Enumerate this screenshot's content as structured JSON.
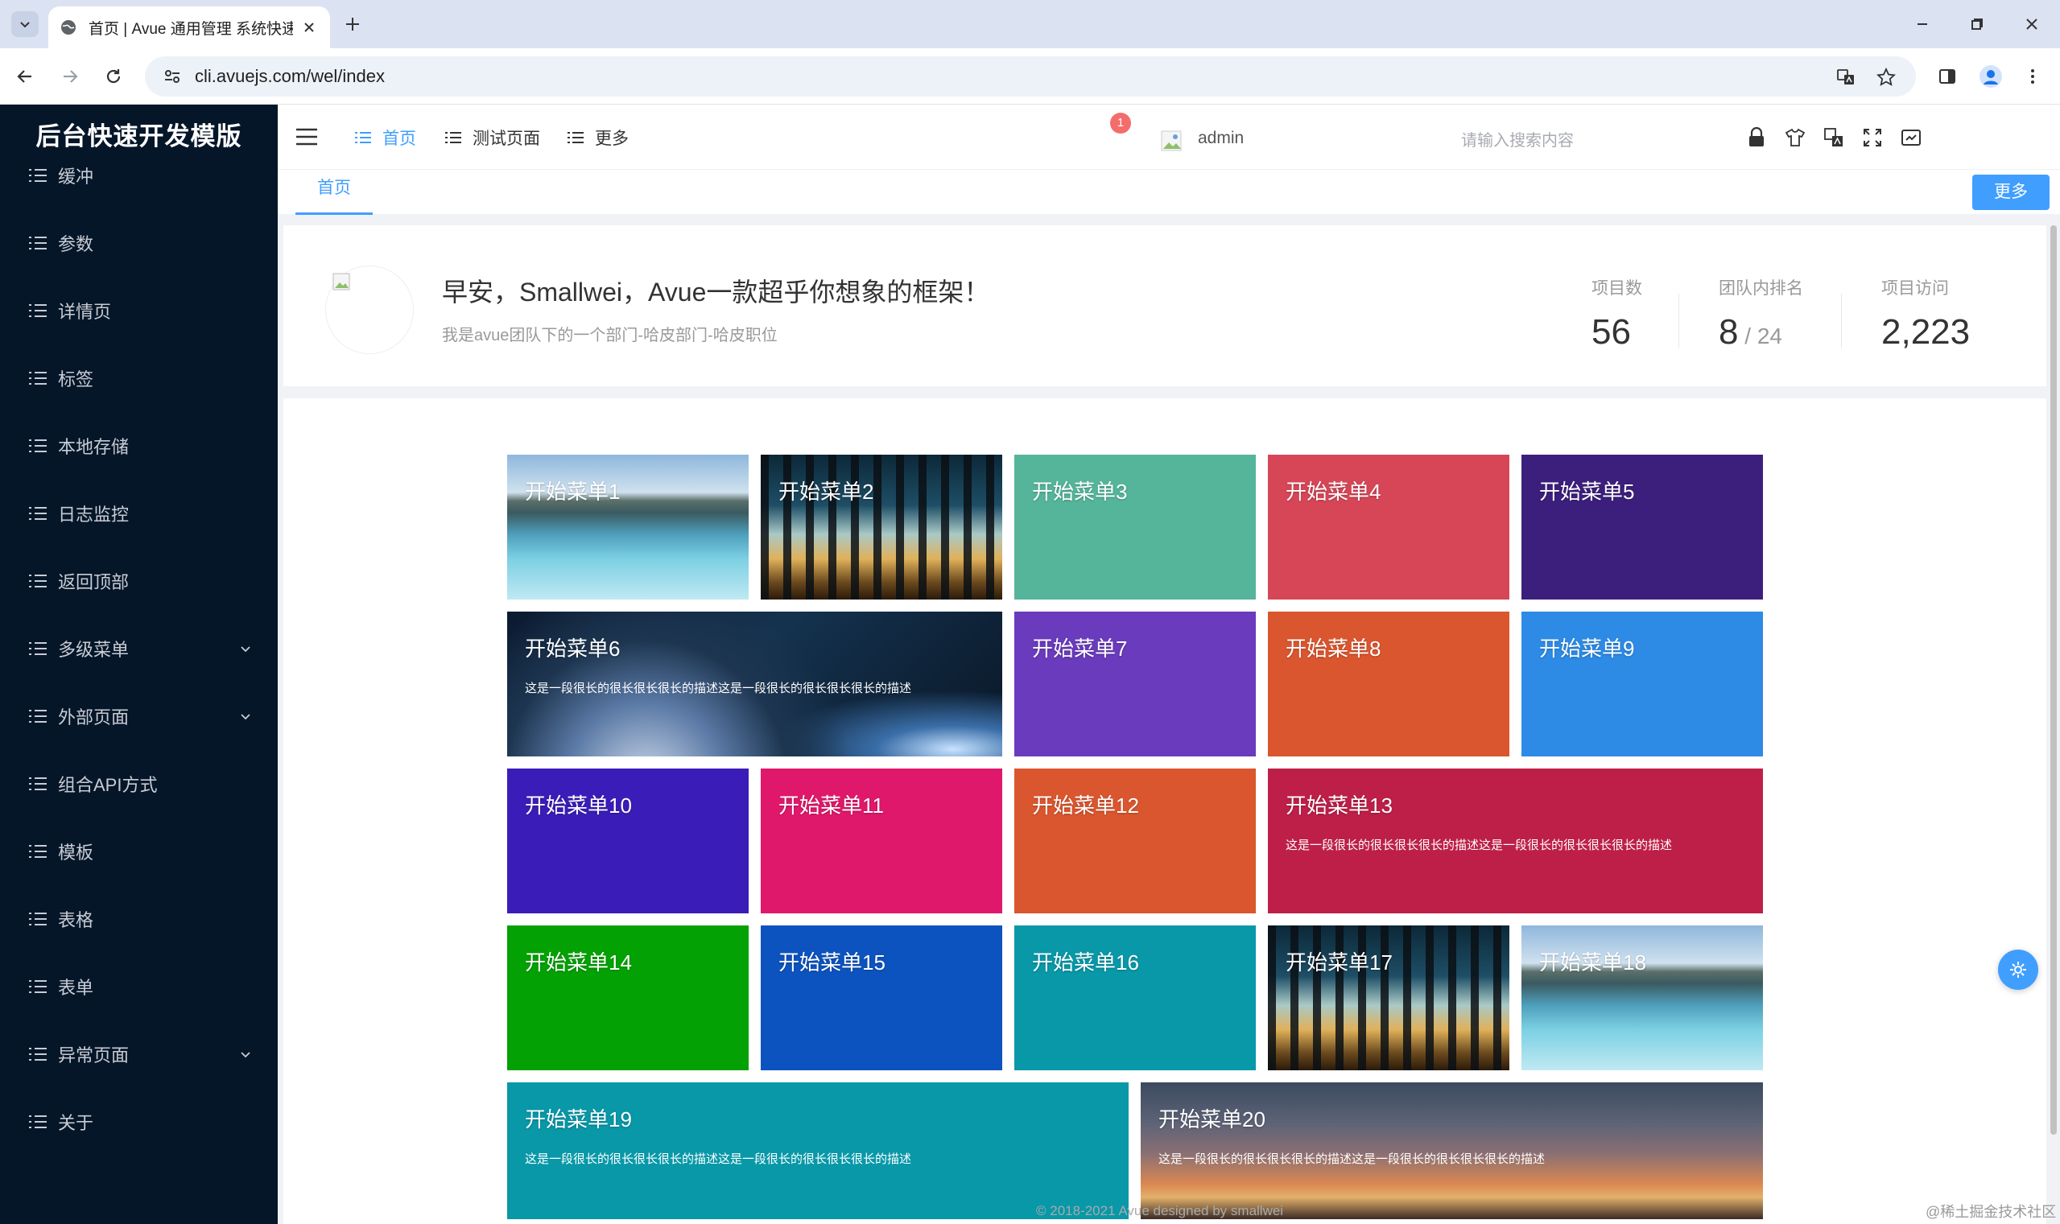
{
  "browser": {
    "tab_title": "首页 | Avue 通用管理 系统快速",
    "url": "cli.avuejs.com/wel/index"
  },
  "sidebar": {
    "logo": "后台快速开发模版",
    "items": [
      {
        "label": "缓冲",
        "expandable": false
      },
      {
        "label": "参数",
        "expandable": false
      },
      {
        "label": "详情页",
        "expandable": false
      },
      {
        "label": "标签",
        "expandable": false
      },
      {
        "label": "本地存储",
        "expandable": false
      },
      {
        "label": "日志监控",
        "expandable": false
      },
      {
        "label": "返回顶部",
        "expandable": false
      },
      {
        "label": "多级菜单",
        "expandable": true
      },
      {
        "label": "外部页面",
        "expandable": true
      },
      {
        "label": "组合API方式",
        "expandable": false
      },
      {
        "label": "模板",
        "expandable": false
      },
      {
        "label": "表格",
        "expandable": false
      },
      {
        "label": "表单",
        "expandable": false
      },
      {
        "label": "异常页面",
        "expandable": true
      },
      {
        "label": "关于",
        "expandable": false
      }
    ]
  },
  "header": {
    "nav": [
      "首页",
      "测试页面",
      "更多"
    ],
    "search_placeholder": "请输入搜索内容",
    "badge_count": "1",
    "username": "admin"
  },
  "tags": {
    "home": "首页",
    "more": "更多"
  },
  "welcome": {
    "greeting": "早安，Smallwei，Avue一款超乎你想象的框架！",
    "subline": "我是avue团队下的一个部门-哈皮部门-哈皮职位",
    "stats": [
      {
        "label": "项目数",
        "value": "56",
        "suffix": ""
      },
      {
        "label": "团队内排名",
        "value": "8",
        "suffix": " / 24"
      },
      {
        "label": "项目访问",
        "value": "2,223",
        "suffix": ""
      }
    ]
  },
  "tiles": [
    {
      "title": "开始菜单1",
      "desc": ""
    },
    {
      "title": "开始菜单2",
      "desc": ""
    },
    {
      "title": "开始菜单3",
      "desc": ""
    },
    {
      "title": "开始菜单4",
      "desc": ""
    },
    {
      "title": "开始菜单5",
      "desc": ""
    },
    {
      "title": "开始菜单6",
      "desc": "这是一段很长的很长很长很长的描述这是一段很长的很长很长很长的描述"
    },
    {
      "title": "开始菜单7",
      "desc": ""
    },
    {
      "title": "开始菜单8",
      "desc": ""
    },
    {
      "title": "开始菜单9",
      "desc": ""
    },
    {
      "title": "开始菜单10",
      "desc": ""
    },
    {
      "title": "开始菜单11",
      "desc": ""
    },
    {
      "title": "开始菜单12",
      "desc": ""
    },
    {
      "title": "开始菜单13",
      "desc": "这是一段很长的很长很长很长的描述这是一段很长的很长很长很长的描述"
    },
    {
      "title": "开始菜单14",
      "desc": ""
    },
    {
      "title": "开始菜单15",
      "desc": ""
    },
    {
      "title": "开始菜单16",
      "desc": ""
    },
    {
      "title": "开始菜单17",
      "desc": ""
    },
    {
      "title": "开始菜单18",
      "desc": ""
    },
    {
      "title": "开始菜单19",
      "desc": "这是一段很长的很长很长很长的描述这是一段很长的很长很长很长的描述"
    },
    {
      "title": "开始菜单20",
      "desc": "这是一段很长的很长很长很长的描述这是一段很长的很长很长很长的描述"
    }
  ],
  "colors": {
    "sidebar_bg": "#051629",
    "accent": "#409eff",
    "tile3": "#55b59a",
    "tile4": "#d64657",
    "tile5": "#3c1f7c",
    "tile7": "#6a3bbd",
    "tile8": "#da562e",
    "tile9": "#2d8be6",
    "tile10": "#3a1db8",
    "tile11": "#e0186b",
    "tile12": "#da562e",
    "tile13": "#bd1f48",
    "tile14": "#04a104",
    "tile15": "#0d53bf",
    "tile16": "#0898a8",
    "tile19": "#0898a8"
  },
  "footer": {
    "copyright": "© 2018-2021 Avue designed by smallwei",
    "watermark": "@稀土掘金技术社区"
  }
}
